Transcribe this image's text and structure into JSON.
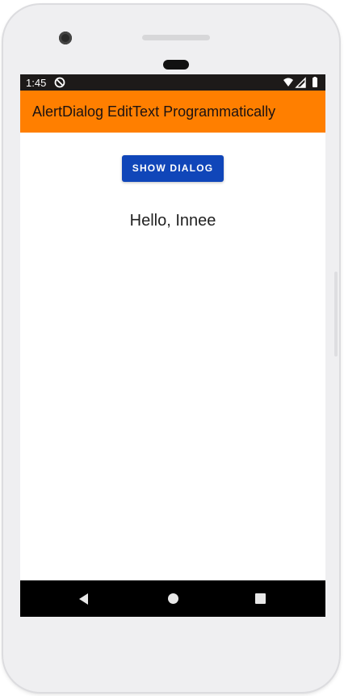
{
  "status_bar": {
    "time": "1:45",
    "icons": [
      "do-not-disturb-icon",
      "wifi-icon",
      "signal-icon",
      "battery-icon"
    ]
  },
  "app_bar": {
    "title": "AlertDialog EditText Programmatically",
    "color": "#ff7f00"
  },
  "main": {
    "show_dialog_button": "SHOW DIALOG",
    "button_color": "#1046b9",
    "greeting_text": "Hello, Innee"
  },
  "nav_bar": {
    "icons": [
      "back-icon",
      "home-icon",
      "recents-icon"
    ]
  }
}
